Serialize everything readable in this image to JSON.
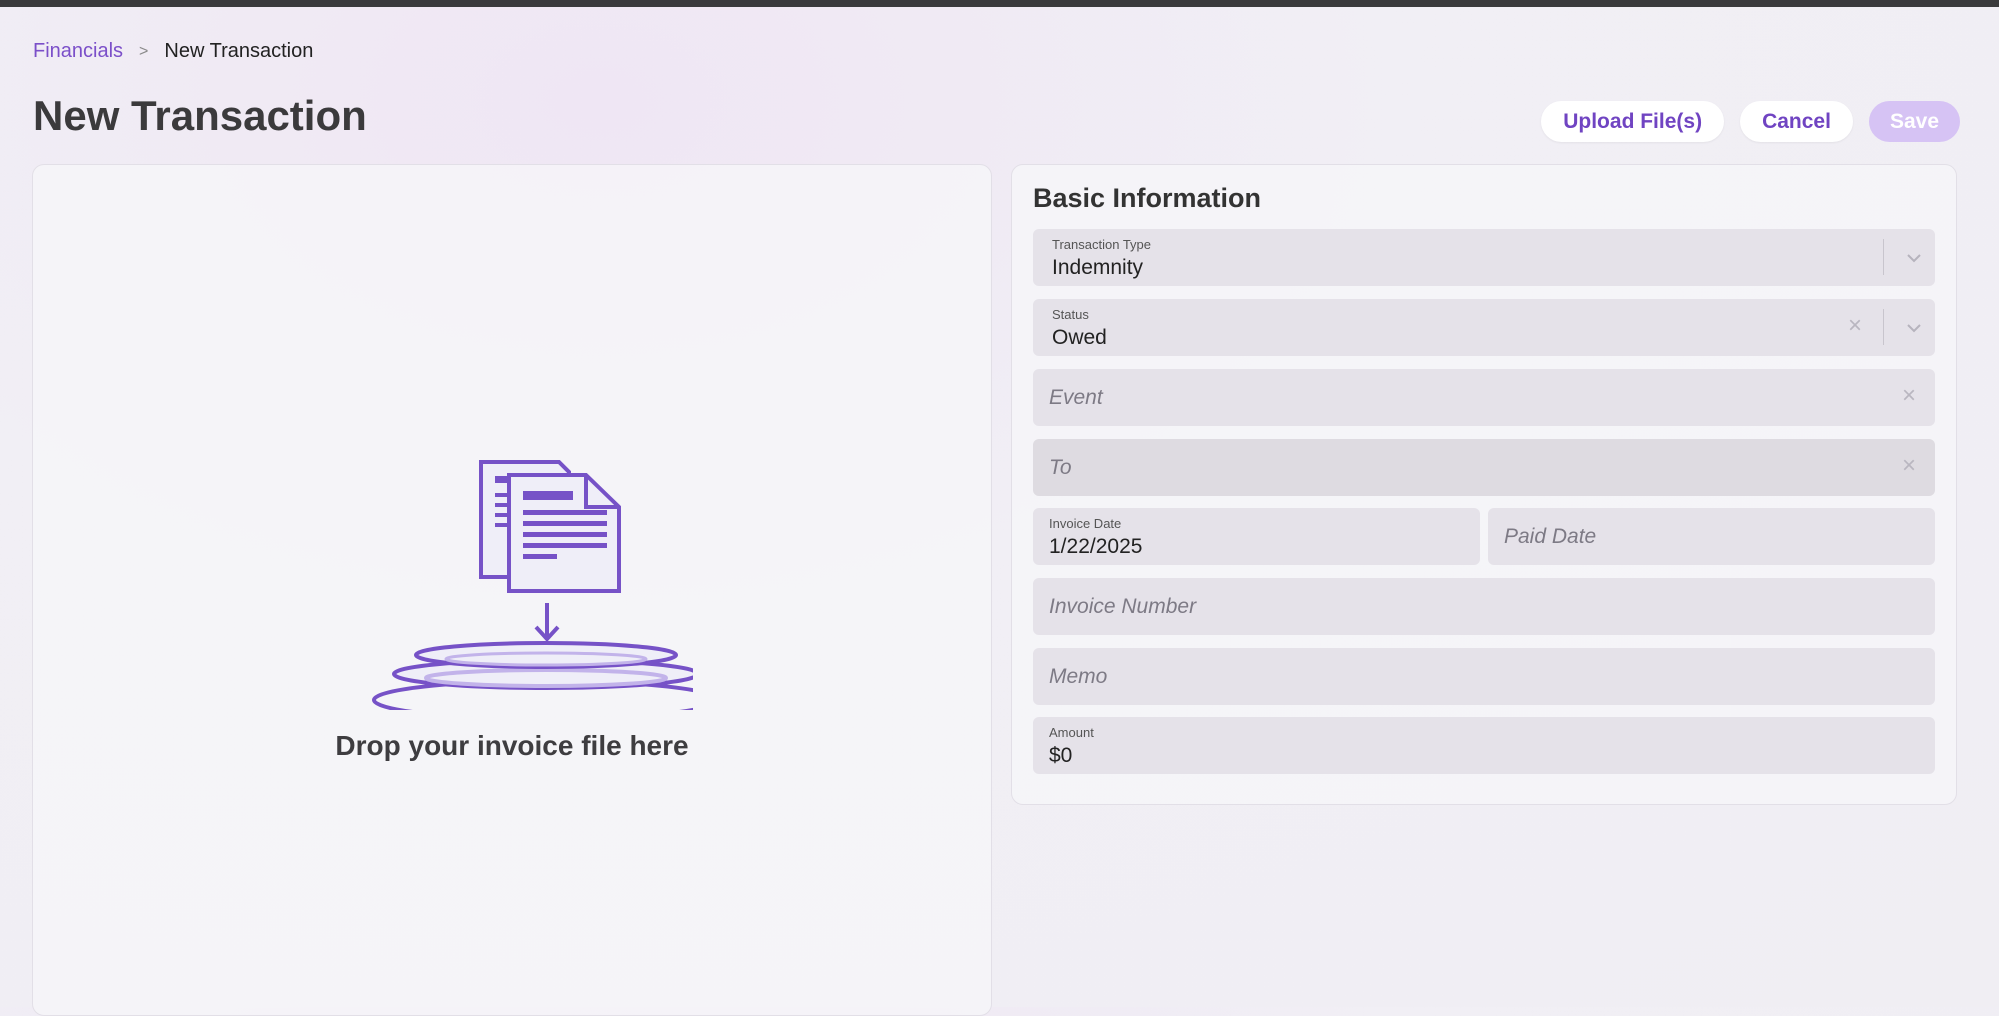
{
  "breadcrumb": {
    "parent": "Financials",
    "separator": ">",
    "current": "New Transaction"
  },
  "page": {
    "title": "New Transaction"
  },
  "actions": {
    "upload": "Upload File(s)",
    "cancel": "Cancel",
    "save": "Save"
  },
  "dropzone": {
    "text": "Drop your invoice file here",
    "icon": "document-drop-icon"
  },
  "basic_info": {
    "title": "Basic Information",
    "transaction_type": {
      "label": "Transaction Type",
      "value": "Indemnity"
    },
    "status": {
      "label": "Status",
      "value": "Owed"
    },
    "event": {
      "placeholder": "Event"
    },
    "to": {
      "placeholder": "To"
    },
    "invoice_date": {
      "label": "Invoice Date",
      "value": "1/22/2025"
    },
    "paid_date": {
      "placeholder": "Paid Date"
    },
    "invoice_number": {
      "placeholder": "Invoice Number"
    },
    "memo": {
      "placeholder": "Memo"
    },
    "amount": {
      "label": "Amount",
      "value": "$0"
    }
  },
  "colors": {
    "accent": "#7b4fc9",
    "save_disabled": "#d6c3f4",
    "title": "#3b3a3c"
  }
}
